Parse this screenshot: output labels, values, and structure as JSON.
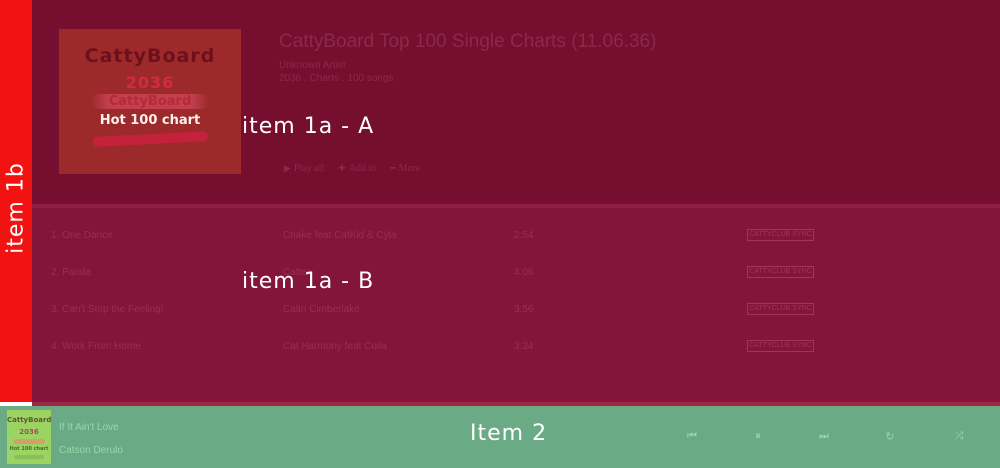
{
  "overlays": {
    "sidebar_label": "item 1b",
    "header_label": "item 1a - A",
    "tracklist_label": "item 1a - B",
    "player_label": "Item 2"
  },
  "album": {
    "cover_text": [
      "CattyBoard",
      "2036",
      "CattyBoard",
      "Hot 100 chart"
    ],
    "title": "CattyBoard Top 100 Single Charts (11.06.36)",
    "artist": "Unknown Artist",
    "meta": "2036 . Charts . 100 songs",
    "actions": [
      {
        "icon": "play-icon",
        "glyph": "▶",
        "label": "Play all"
      },
      {
        "icon": "plus-icon",
        "glyph": "✚",
        "label": "Add to"
      },
      {
        "icon": "more-icon",
        "glyph": "━",
        "label": "More"
      }
    ]
  },
  "tracks": [
    {
      "title": "1. One Dance",
      "artist": "Cnake feat CatKid & Cyla",
      "duration": "2:54",
      "badge": "CATTYCLUB SYNC"
    },
    {
      "title": "2. Panda",
      "artist": "Catter",
      "duration": "4:06",
      "badge": "CATTYCLUB SYNC"
    },
    {
      "title": "3. Can't Stop the Feeling!",
      "artist": "Catin Cimberlake",
      "duration": "3:56",
      "badge": "CATTYCLUB SYNC"
    },
    {
      "title": "4. Work From Home",
      "artist": "Cat Harmony feat Coila",
      "duration": "3:34",
      "badge": "CATTYCLUB SYNC"
    }
  ],
  "player": {
    "cover_text": [
      "CattyBoard",
      "2036",
      "Hot 100 chart"
    ],
    "song": "If It Ain't Love",
    "artist": "Catson Derulo",
    "controls": [
      {
        "name": "previous-button",
        "icon": "skip-back-icon",
        "glyph": "⏮"
      },
      {
        "name": "pause-button",
        "icon": "pause-icon",
        "glyph": "⏸"
      },
      {
        "name": "next-button",
        "icon": "skip-forward-icon",
        "glyph": "⏭"
      },
      {
        "name": "repeat-button",
        "icon": "repeat-icon",
        "glyph": "↻"
      },
      {
        "name": "shuffle-button",
        "icon": "shuffle-icon",
        "glyph": "⤨"
      }
    ]
  },
  "colors": {
    "sidebar": "#f21212",
    "header_bg": "#760e30",
    "tracklist_bg": "#83143a",
    "player_bg": "#6aab86"
  }
}
